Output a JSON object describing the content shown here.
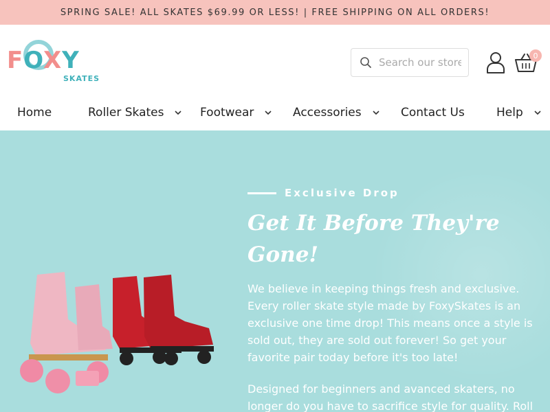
{
  "announcement": "SPRING SALE! ALL SKATES $69.99 OR LESS! | FREE SHIPPING ON ALL ORDERS!",
  "logo": {
    "main_text": [
      "F",
      "O",
      "X",
      "Y"
    ],
    "sub_text": "SKATES",
    "colors": {
      "pink": "#f28e8c",
      "teal": "#3fb1ba"
    }
  },
  "search": {
    "placeholder": "Search our store",
    "value": ""
  },
  "cart": {
    "count": "0"
  },
  "nav": {
    "items": [
      {
        "label": "Home",
        "has_dropdown": false
      },
      {
        "label": "Roller Skates",
        "has_dropdown": true
      },
      {
        "label": "Footwear",
        "has_dropdown": true
      },
      {
        "label": "Accessories",
        "has_dropdown": true
      },
      {
        "label": "Contact Us",
        "has_dropdown": false
      },
      {
        "label": "Help",
        "has_dropdown": true
      }
    ]
  },
  "hero": {
    "eyebrow": "Exclusive Drop",
    "headline": "Get It Before They're Gone!",
    "paragraphs": [
      "We believe in keeping things fresh and exclusive. Every roller skate style made by FoxySkates is an exclusive one time drop! This means once a style is sold out, they are sold out forever! So get your favorite pair today before it's too late!",
      "Designed for beginners and avanced skaters, no longer do you have to sacrifice style for quality. Roll in a new"
    ],
    "background_color": "#a9dddd"
  },
  "colors": {
    "announcement_bg": "#f7c3bd",
    "badge_bg": "#f7b6b0"
  },
  "icons": [
    "search-icon",
    "account-icon",
    "cart-icon",
    "chevron-down-icon"
  ]
}
